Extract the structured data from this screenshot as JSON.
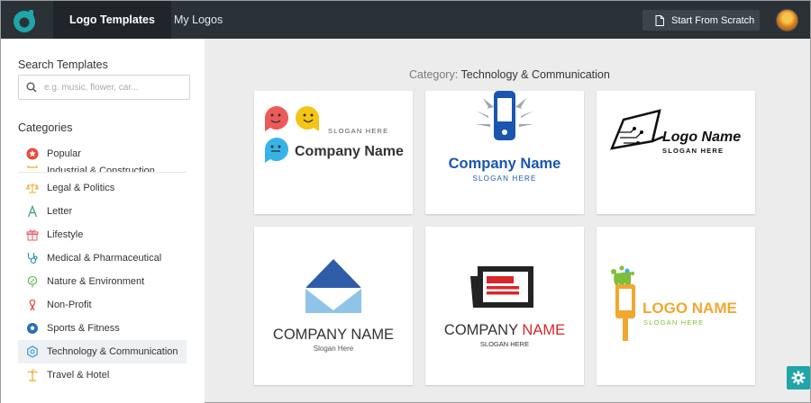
{
  "header": {
    "tabs": [
      {
        "label": "Logo Templates",
        "active": true
      },
      {
        "label": "My Logos",
        "active": false
      }
    ],
    "start_button_label": "Start From Scratch"
  },
  "sidebar": {
    "search_heading": "Search Templates",
    "search_placeholder": "e.g. music, flower, car...",
    "categories_heading": "Categories",
    "categories": [
      {
        "label": "Popular",
        "icon": "star-badge-icon"
      },
      {
        "label": "Industrial & Construction",
        "icon": "hardhat-icon",
        "clipped": true
      },
      {
        "label": "Legal & Politics",
        "icon": "scales-icon"
      },
      {
        "label": "Letter",
        "icon": "letter-a-icon"
      },
      {
        "label": "Lifestyle",
        "icon": "gift-icon"
      },
      {
        "label": "Medical & Pharmaceutical",
        "icon": "stethoscope-icon"
      },
      {
        "label": "Nature & Environment",
        "icon": "tree-icon"
      },
      {
        "label": "Non-Profit",
        "icon": "ribbon-icon"
      },
      {
        "label": "Sports & Fitness",
        "icon": "soccer-ball-icon"
      },
      {
        "label": "Technology & Communication",
        "icon": "chip-icon",
        "selected": true
      },
      {
        "label": "Travel & Hotel",
        "icon": "palm-tree-icon"
      }
    ]
  },
  "main": {
    "category_prefix": "Category: ",
    "category_value": "Technology & Communication",
    "logos": [
      {
        "name": "Company Name",
        "slogan": "SLOGAN HERE"
      },
      {
        "name": "Company Name",
        "slogan": "SLOGAN HERE"
      },
      {
        "name": "Logo Name",
        "slogan": "SLOGAN HERE"
      },
      {
        "name": "COMPANY NAME",
        "slogan": "Slogan Here"
      },
      {
        "name_part1": "COMPANY",
        "name_part2": " NAME",
        "slogan": "SLOGAN HERE"
      },
      {
        "name": "LOGO NAME",
        "slogan": "SLOGAN HERE"
      }
    ]
  },
  "colors": {
    "accent": "#20a5a9",
    "topbar": "#2b3237",
    "brand_blue": "#1a56b0",
    "orange": "#f0a830",
    "red": "#d9262c"
  }
}
